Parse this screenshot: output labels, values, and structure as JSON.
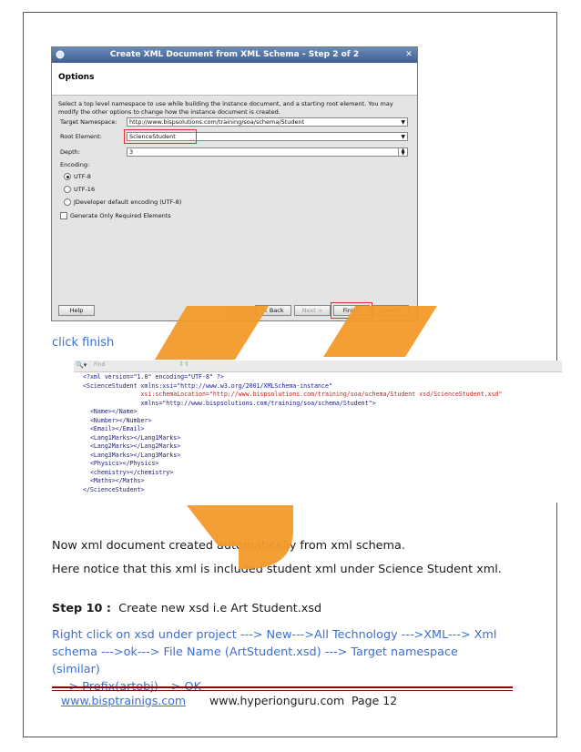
{
  "dialog": {
    "title": "Create XML Document from XML Schema - Step 2 of 2",
    "heading": "Options",
    "description": "Select a top level namespace to use while building the instance document, and a starting root element. You may modify the other options to change how the instance document is created.",
    "target_namespace_label": "Target Namespace:",
    "target_namespace_value": "http://www.bispsolutions.com/training/soa/schema/Student",
    "root_element_label": "Root Element:",
    "root_element_value": "ScienceStudent",
    "depth_label": "Depth:",
    "depth_value": "3",
    "encoding_label": "Encoding:",
    "encoding_options": [
      "UTF-8",
      "UTF-16",
      "JDeveloper default encoding (UTF-8)"
    ],
    "encoding_selected": "UTF-8",
    "generate_required_label": "Generate Only Required Elements",
    "help_button": "Help",
    "back_button": "< Back",
    "next_button": "Next >",
    "finish_button": "Finish",
    "cancel_button": "Cancel"
  },
  "caption_click_finish": "click finish",
  "editor": {
    "find_placeholder": "Find",
    "lines": [
      "<?xml version=\"1.0\" encoding=\"UTF-8\" ?>",
      "<ScienceStudent xmlns:xsi=\"http://www.w3.org/2001/XMLSchema-instance\"",
      "                xsi:schemaLocation=\"http://www.bispsolutions.com/training/soa/schema/Student xsd/ScienceStudent.xsd\"",
      "                xmlns=\"http://www.bispsolutions.com/training/soa/schema/Student\">",
      "  <Name></Name>",
      "  <Number></Number>",
      "  <Email></Email>",
      "  <Lang1Marks></Lang1Marks>",
      "  <Lang2Marks></Lang2Marks>",
      "  <Lang3Marks></Lang3Marks>",
      "  <Physics></Physics>",
      "  <chemistry></chemistry>",
      "  <Maths></Maths>",
      "</ScienceStudent>"
    ]
  },
  "paragraph_1": "Now xml document created automatically from xml schema.",
  "paragraph_2": "Here notice that this xml is included student xml under Science Student xml.",
  "step_label": "Step 10 :",
  "step_text": "Create new xsd i.e Art Student.xsd",
  "instruction_lines": [
    "Right click on xsd under project ---> New--->All Technology --->XML---> Xml",
    "schema --->ok---> File Name (ArtStudent.xsd) ---> Target namespace (similar)",
    "----> Prefix(artobj)---> OK"
  ],
  "footer": {
    "link": "www.bisptrainigs.com",
    "site": "www.hyperionguru.com",
    "page": "Page 12"
  },
  "colors": {
    "link_blue": "#3d6fcf",
    "highlight_red": "#e03030",
    "watermark_orange": "#f39a2b",
    "footer_rule": "#8b0000"
  }
}
